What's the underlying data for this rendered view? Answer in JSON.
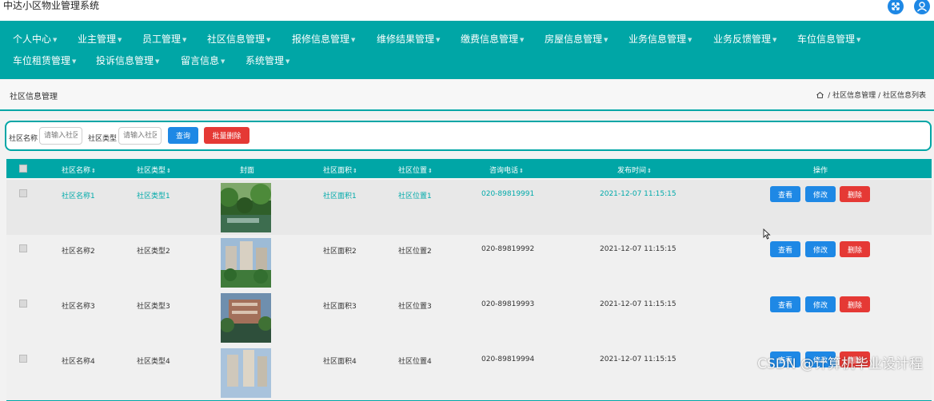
{
  "app": {
    "title": "中达小区物业管理系统"
  },
  "header_icons": [
    "fullscreen-icon",
    "user-icon"
  ],
  "nav": {
    "items": [
      {
        "label": "个人中心",
        "has_dropdown": true
      },
      {
        "label": "业主管理",
        "has_dropdown": true
      },
      {
        "label": "员工管理",
        "has_dropdown": true
      },
      {
        "label": "社区信息管理",
        "has_dropdown": true
      },
      {
        "label": "报修信息管理",
        "has_dropdown": true
      },
      {
        "label": "维修结果管理",
        "has_dropdown": true
      },
      {
        "label": "缴费信息管理",
        "has_dropdown": true
      },
      {
        "label": "房屋信息管理",
        "has_dropdown": true
      },
      {
        "label": "业务信息管理",
        "has_dropdown": true
      },
      {
        "label": "业务反馈管理",
        "has_dropdown": true
      },
      {
        "label": "车位信息管理",
        "has_dropdown": true
      },
      {
        "label": "车位租赁管理",
        "has_dropdown": true
      },
      {
        "label": "投诉信息管理",
        "has_dropdown": true
      },
      {
        "label": "留言信息",
        "has_dropdown": true
      },
      {
        "label": "系统管理",
        "has_dropdown": true
      }
    ]
  },
  "page": {
    "title": "社区信息管理",
    "breadcrumb": [
      "社区信息管理",
      "社区信息列表"
    ],
    "breadcrumb_sep": "/"
  },
  "search": {
    "name_label": "社区名称",
    "name_placeholder": "请输入社区",
    "type_label": "社区类型",
    "type_placeholder": "请输入社区",
    "query_button": "查询",
    "batch_delete_button": "批量删除"
  },
  "table": {
    "columns": [
      "社区名称",
      "社区类型",
      "封面",
      "社区面积",
      "社区位置",
      "咨询电话",
      "发布时间",
      "操作"
    ],
    "sort_glyph": "⇕",
    "rows": [
      {
        "name": "社区名称1",
        "type": "社区类型1",
        "area": "社区面积1",
        "location": "社区位置1",
        "phone": "020-89819991",
        "time": "2021-12-07 11:15:15"
      },
      {
        "name": "社区名称2",
        "type": "社区类型2",
        "area": "社区面积2",
        "location": "社区位置2",
        "phone": "020-89819992",
        "time": "2021-12-07 11:15:15"
      },
      {
        "name": "社区名称3",
        "type": "社区类型3",
        "area": "社区面积3",
        "location": "社区位置3",
        "phone": "020-89819993",
        "time": "2021-12-07 11:15:15"
      },
      {
        "name": "社区名称4",
        "type": "社区类型4",
        "area": "社区面积4",
        "location": "社区位置4",
        "phone": "020-89819994",
        "time": "2021-12-07 11:15:15"
      }
    ],
    "actions": {
      "view": "查看",
      "edit": "修改",
      "delete": "删除"
    }
  },
  "watermark": "CSDN @计算机毕业设计程",
  "colors": {
    "theme": "#00a6a6",
    "primary": "#1e88e5",
    "danger": "#e53935"
  }
}
